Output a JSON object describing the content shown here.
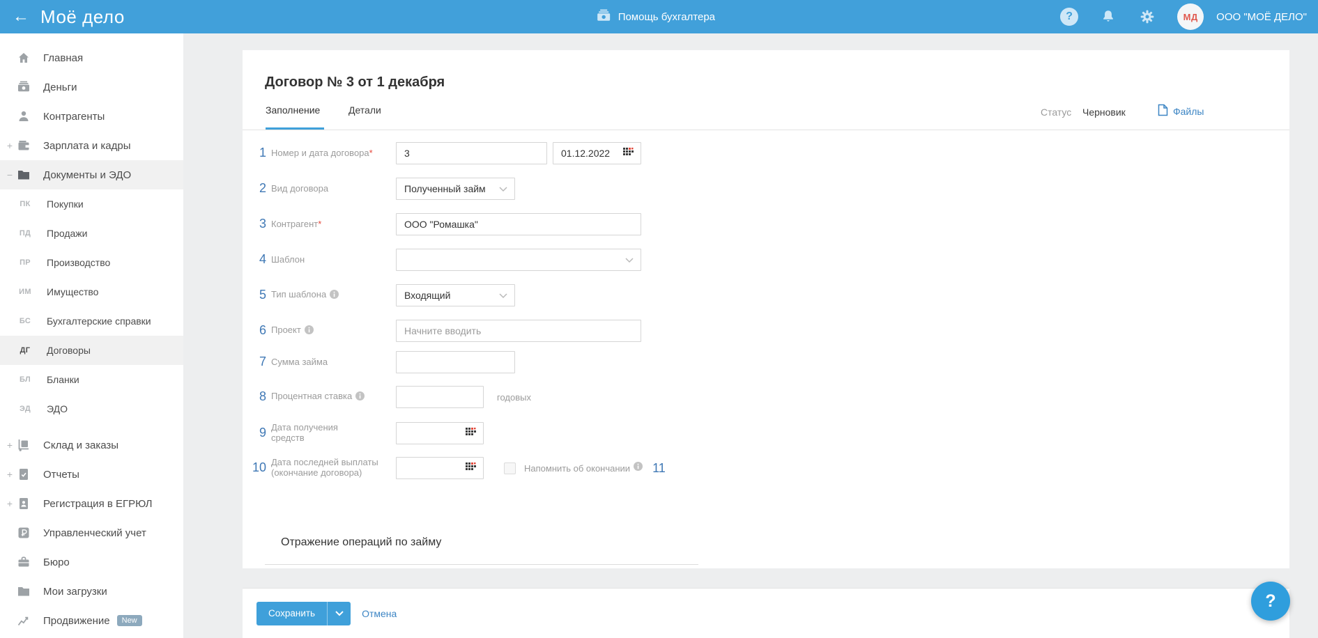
{
  "header": {
    "back_icon": "←",
    "logo": "Моё дело",
    "help_center": "Помощь бухгалтера",
    "avatar_initials": "МД",
    "org_name": "ООО \"МОЁ ДЕЛО\""
  },
  "sidebar": {
    "items": [
      {
        "id": "glavnaya",
        "type": "main",
        "icon": "home",
        "label": "Главная"
      },
      {
        "id": "dengi",
        "type": "main",
        "icon": "money",
        "label": "Деньги"
      },
      {
        "id": "kontragenty",
        "type": "main",
        "icon": "person",
        "label": "Контрагенты"
      },
      {
        "id": "zarplata-i-kadry",
        "type": "main",
        "icon": "wallet",
        "label": "Зарплата и кадры",
        "expand": "+"
      },
      {
        "id": "dokumenty-i-edo",
        "type": "main",
        "icon": "folder",
        "label": "Документы и ЭДО",
        "expand": "−",
        "active": true
      },
      {
        "id": "pokupki",
        "type": "sub",
        "abbr": "ПК",
        "label": "Покупки"
      },
      {
        "id": "prodazhi",
        "type": "sub",
        "abbr": "ПД",
        "label": "Продажи"
      },
      {
        "id": "proizvodstvo",
        "type": "sub",
        "abbr": "ПР",
        "label": "Производство"
      },
      {
        "id": "imushchestvo",
        "type": "sub",
        "abbr": "ИМ",
        "label": "Имущество"
      },
      {
        "id": "buhgalterskie-spravki",
        "type": "sub",
        "abbr": "БС",
        "label": "Бухгалтерские справки"
      },
      {
        "id": "dogovory",
        "type": "sub",
        "abbr": "ДГ",
        "label": "Договоры",
        "active": true
      },
      {
        "id": "blanki",
        "type": "sub",
        "abbr": "БЛ",
        "label": "Бланки"
      },
      {
        "id": "edo",
        "type": "sub",
        "abbr": "ЭД",
        "label": "ЭДО"
      },
      {
        "id": "sklad-i-zakazy",
        "type": "main",
        "icon": "cart",
        "label": "Склад и заказы",
        "expand": "+",
        "gap": true
      },
      {
        "id": "otchety",
        "type": "main",
        "icon": "report",
        "label": "Отчеты",
        "expand": "+"
      },
      {
        "id": "registratsiya-v-egrul",
        "type": "main",
        "icon": "docperson",
        "label": "Регистрация в ЕГРЮЛ",
        "expand": "+"
      },
      {
        "id": "upravlencheskiy-uchet",
        "type": "main",
        "icon": "ruble",
        "label": "Управленческий учет"
      },
      {
        "id": "byuro",
        "type": "main",
        "icon": "briefcase",
        "label": "Бюро"
      },
      {
        "id": "moi-zagruzki",
        "type": "main",
        "icon": "folder2",
        "label": "Мои загрузки"
      },
      {
        "id": "prodvizhenie",
        "type": "main",
        "icon": "chart",
        "label": "Продвижение",
        "badge": "New"
      }
    ]
  },
  "contract": {
    "title": "Договор № 3 от 1 декабря",
    "tabs": [
      {
        "label": "Заполнение"
      },
      {
        "label": "Детали"
      }
    ],
    "status_label": "Статус",
    "status_value": "Черновик",
    "files_label": "Файлы",
    "rows": [
      {
        "num": "1",
        "label": "Номер и дата договора",
        "required": "*",
        "value": "3",
        "date_value": "01.12.2022"
      },
      {
        "num": "2",
        "label": "Вид договора",
        "value": "Полученный займ"
      },
      {
        "num": "3",
        "label": "Контрагент",
        "required": "*",
        "value": "ООО \"Ромашка\""
      },
      {
        "num": "4",
        "label": "Шаблон",
        "value": ""
      },
      {
        "num": "5",
        "label": "Тип шаблона",
        "value": "Входящий"
      },
      {
        "num": "6",
        "label": "Проект",
        "placeholder": "Начните вводить"
      },
      {
        "num": "7",
        "label": "Сумма займа",
        "value": ""
      },
      {
        "num": "8",
        "label": "Процентная ставка",
        "suffix": "годовых"
      },
      {
        "num": "9",
        "label": "Дата получения средств",
        "date_value": ""
      },
      {
        "num": "10",
        "label": "Дата последней выплаты (окончание договора)",
        "date_value": ""
      },
      {
        "num": "11",
        "checkbox_label": "Напомнить об окончании"
      }
    ],
    "section_title": "Отражение операций по займу"
  },
  "footer": {
    "save_label": "Сохранить",
    "cancel_label": "Отмена"
  },
  "fab_help_glyph": "?",
  "colors": {
    "accent_blue": "#41a0da",
    "link_blue": "#3c85c4",
    "number_blue": "#3f78b5",
    "required_red": "#e5493d"
  }
}
